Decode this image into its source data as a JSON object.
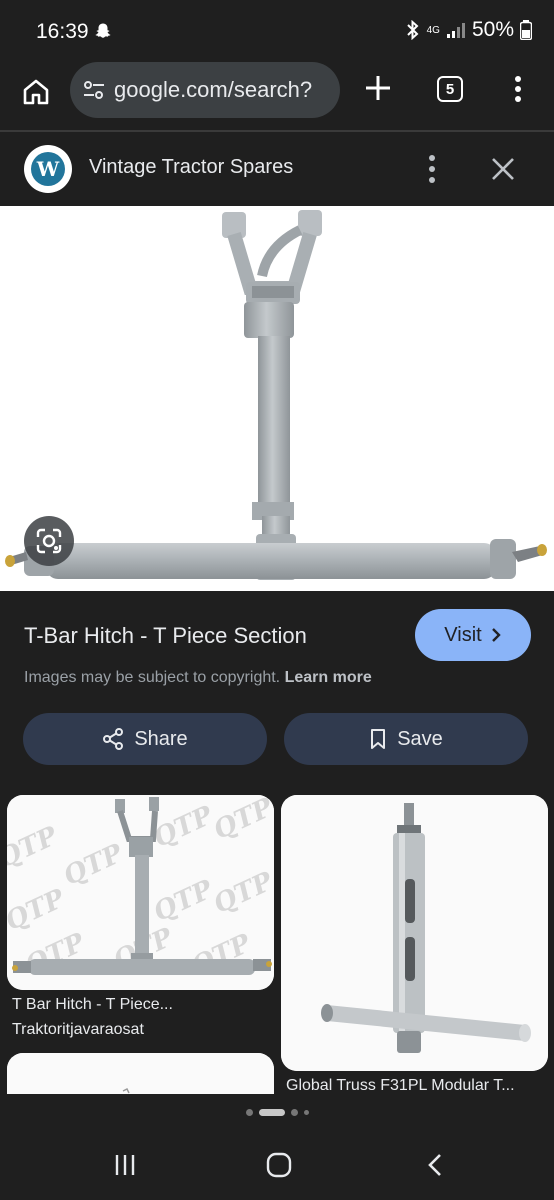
{
  "status_bar": {
    "time": "16:39",
    "network": "4G",
    "battery": "50%"
  },
  "browser": {
    "url": "google.com/search?",
    "tab_count": "5"
  },
  "site": {
    "name": "Vintage Tractor Spares",
    "logo_letter": "W"
  },
  "result": {
    "title": "T-Bar Hitch - T Piece Section",
    "visit_label": "Visit",
    "copyright_text": "Images may be subject to copyright.",
    "learn_more": "Learn more",
    "share_label": "Share",
    "save_label": "Save"
  },
  "related": [
    {
      "title": "T Bar Hitch - T Piece...",
      "source": "Traktoritjavaraosat",
      "watermark": "QTP"
    },
    {
      "title": "Global Truss F31PL Modular T...",
      "source": ""
    }
  ],
  "icons": {
    "home": "home-icon",
    "tune": "tune-icon",
    "plus": "plus-icon",
    "menu": "more-vert-icon",
    "close": "close-icon",
    "lens": "google-lens-icon",
    "share": "share-icon",
    "save": "bookmark-icon"
  },
  "colors": {
    "background": "#1f1f1f",
    "accent": "#8ab4f8",
    "action_button": "#303a4e"
  }
}
